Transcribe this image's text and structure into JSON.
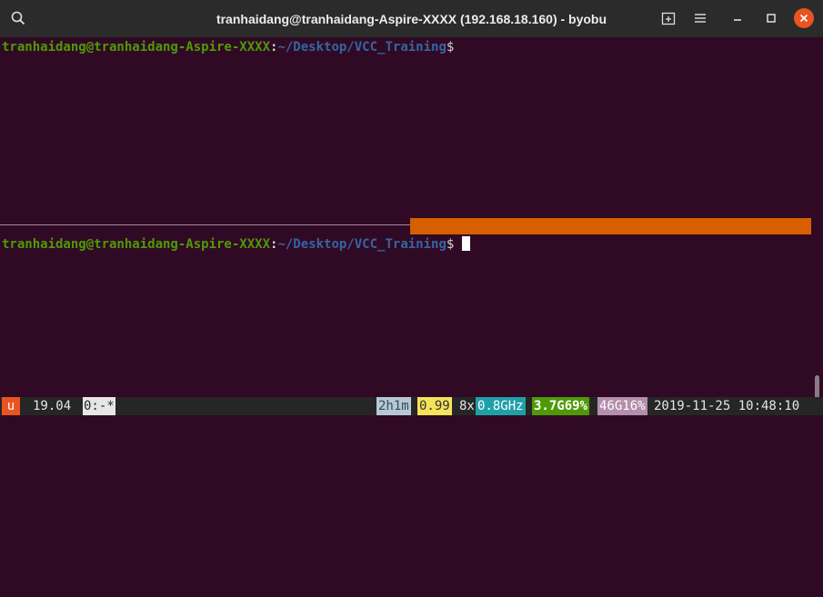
{
  "window": {
    "title": "tranhaidang@tranhaidang-Aspire-XXXX (192.168.18.160) - byobu"
  },
  "panes": [
    {
      "user_host": "tranhaidang@tranhaidang-Aspire-XXXX",
      "colon": ":",
      "path": "~/Desktop/VCC_Training",
      "prompt": "$"
    },
    {
      "user_host": "tranhaidang@tranhaidang-Aspire-XXXX",
      "colon": ":",
      "path": "~/Desktop/VCC_Training",
      "prompt": "$"
    }
  ],
  "statusbar": {
    "logo": "u",
    "release": "19.04",
    "window_list": "0:-*",
    "uptime": "2h1m",
    "load": "0.99",
    "cpu_count": "8x",
    "cpu_freq": "0.8GHz",
    "memory": "3.7G69%",
    "disk": "46G16%",
    "datetime": "2019-11-25 10:48:10"
  },
  "colors": {
    "terminal_bg": "#300a24",
    "accent_orange": "#e95420",
    "pane_highlight": "#d75f00"
  },
  "icons": {
    "search": "search-icon",
    "new_tab": "new-tab-icon",
    "menu": "hamburger-menu-icon",
    "minimize": "minimize-icon",
    "maximize": "maximize-icon",
    "close": "close-icon"
  }
}
